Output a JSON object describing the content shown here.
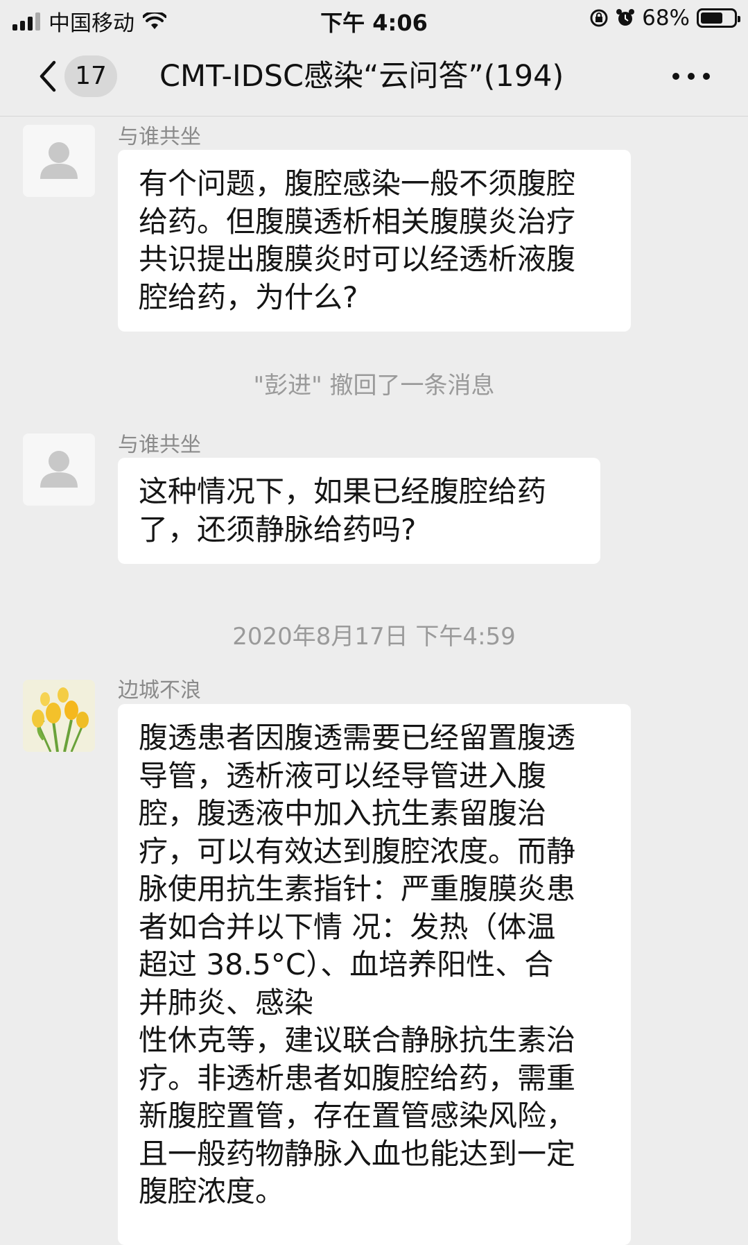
{
  "status": {
    "carrier": "中国移动",
    "time": "下午 4:06",
    "battery": "68%",
    "battery_level": 0.68
  },
  "nav": {
    "unread_count": "17",
    "title": "CMT-IDSC感染“云问答”(194)"
  },
  "messages": [
    {
      "sender": "与谁共坐",
      "avatar": "default-avatar-icon",
      "lines": [
        "有个问题，腹腔感染一般不须腹腔",
        "给药。但腹膜透析相关腹膜炎治疗",
        "共识提出腹膜炎时可以经透析液腹",
        "腔给药，为什么?"
      ]
    },
    {
      "system": "\"彭进\" 撤回了一条消息"
    },
    {
      "sender": "与谁共坐",
      "avatar": "default-avatar-icon",
      "lines": [
        "这种情况下，如果已经腹腔给药",
        "了，还须静脉给药吗?"
      ]
    },
    {
      "timestamp": "2020年8月17日 下午4:59"
    },
    {
      "sender": "边城不浪",
      "avatar": "flower-avatar-icon",
      "lines": [
        "腹透患者因腹透需要已经留置腹透",
        "导管，透析液可以经导管进入腹",
        "腔，腹透液中加入抗生素留腹治",
        "疗，可以有效达到腹腔浓度。而静",
        "脉使用抗生素指针：严重腹膜炎患",
        "者如合并以下情 况：发热（体温",
        "超过 38.5°C）、血培养阳性、合",
        "并肺炎、感染",
        "性休克等，建议联合静脉抗生素治",
        "疗。非透析患者如腹腔给药，需重",
        "新腹腔置管，存在置管感染风险，",
        "且一般药物静脉入血也能达到一定",
        "腹腔浓度。"
      ]
    }
  ]
}
